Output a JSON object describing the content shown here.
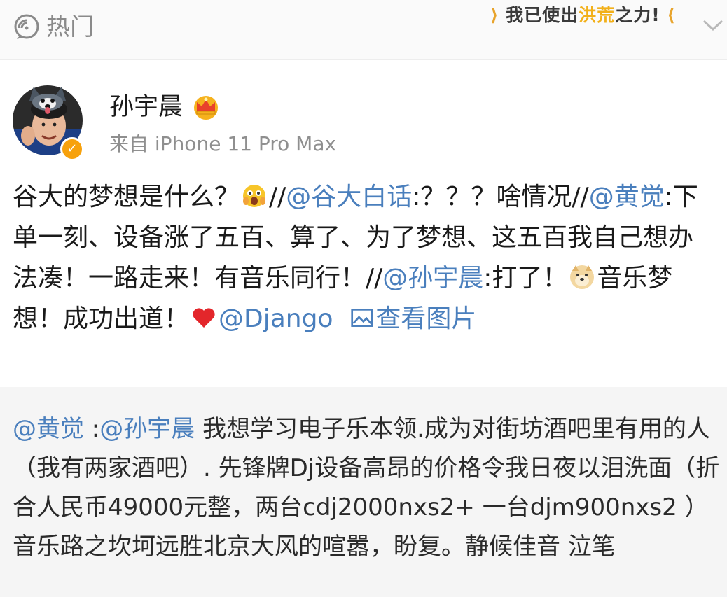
{
  "topbar": {
    "hot_label": "热门",
    "hot_icon": "trending-icon",
    "banner_text_pre": "我已使出",
    "banner_text_hl": "洪荒",
    "banner_text_post": "之力",
    "banner_spark_left": "⁍",
    "banner_spark_right": "!",
    "dropdown_icon": "chevron-down-icon"
  },
  "post": {
    "author": "孙宇晨",
    "author_badge_icon": "crown-icon",
    "verified_icon": "verified-badge-icon",
    "source": "来自 iPhone 11 Pro Max",
    "seg1": "谷大的梦想是什么？",
    "seg2": "//",
    "mention1": "@谷大白话",
    "seg3": ":？？？啥情况//",
    "mention2": "@黄觉",
    "seg4": ":下单一刻、设备涨了五百、算了、为了梦想、这五百我自己想办法凑！一路走来！有音乐同行！//",
    "mention3": "@孙宇晨",
    "seg5": ":打了！",
    "seg6": "音乐梦想！成功出道！",
    "mention4": "@Django",
    "view_image_label": "查看图片",
    "emoji_surprised": "surprised-face-emoji",
    "emoji_doge": "doge-emoji",
    "emoji_heart": "heart-emoji",
    "image_link_icon": "image-icon"
  },
  "quote": {
    "mention1": "@黄觉",
    "colon": " :",
    "mention2": "@孙宇晨",
    "text": " 我想学习电子乐本领.成为对街坊酒吧里有用的人（我有两家酒吧）. 先锋牌Dj设备高昂的价格令我日夜以泪洗面（折合人民币49000元整，两台cdj2000nxs2+ 一台djm900nxs2 ）音乐路之坎坷远胜北京大风的喧嚣，盼复。静候佳音  泣笔"
  },
  "colors": {
    "link": "#4a7fbd",
    "verified": "#f7a10c",
    "muted": "#8f8f8f",
    "quote_bg": "#f5f5f5"
  }
}
